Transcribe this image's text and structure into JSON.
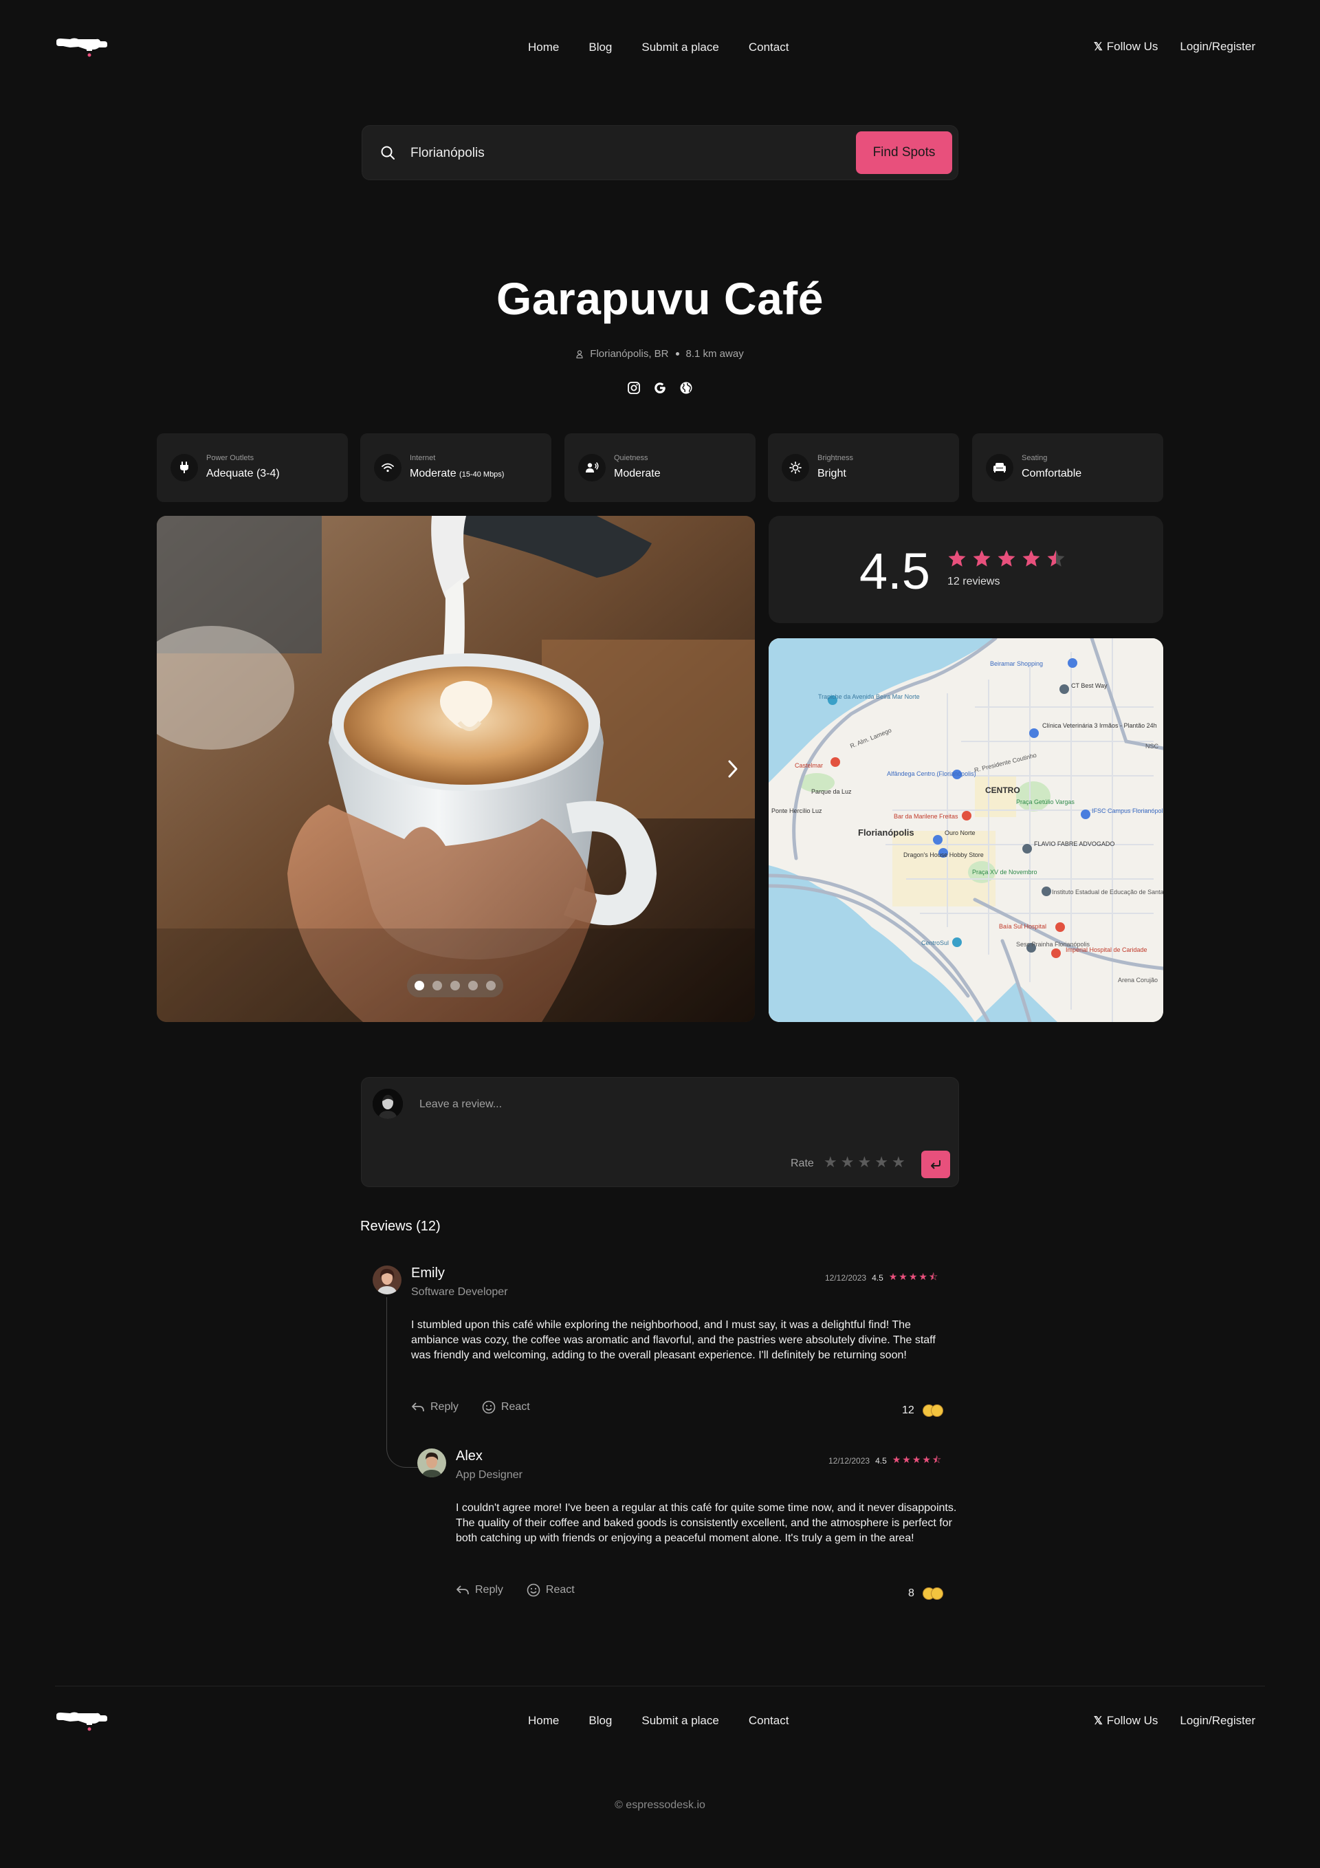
{
  "header": {
    "nav": [
      "Home",
      "Blog",
      "Submit a place",
      "Contact"
    ],
    "follow": "Follow Us",
    "login": "Login/Register"
  },
  "search": {
    "value": "Florianópolis",
    "button": "Find Spots"
  },
  "place": {
    "name": "Garapuvu Café",
    "location": "Florianópolis, BR",
    "distance": "8.1 km away",
    "socials": [
      "instagram-icon",
      "google-icon",
      "globe-icon"
    ]
  },
  "amenities": [
    {
      "label": "Power Outlets",
      "value": "Adequate (3-4)",
      "note": "",
      "icon": "plug-icon"
    },
    {
      "label": "Internet",
      "value": "Moderate",
      "note": "(15-40 Mbps)",
      "icon": "wifi-icon"
    },
    {
      "label": "Quietness",
      "value": "Moderate",
      "note": "",
      "icon": "voice-icon"
    },
    {
      "label": "Brightness",
      "value": "Bright",
      "note": "",
      "icon": "sun-icon"
    },
    {
      "label": "Seating",
      "value": "Comfortable",
      "note": "",
      "icon": "sofa-icon"
    }
  ],
  "gallery": {
    "total": 5,
    "current": 1
  },
  "rating": {
    "score": "4.5",
    "stars": 4.5,
    "reviews": "12 reviews"
  },
  "map": {
    "labels": [
      "CENTRO",
      "Florianópolis",
      "Parque da Luz",
      "Praça XV de Novembro",
      "Baía Sul Hospital",
      "Imperial Hospital de Caridade",
      "Instituto Estadual de Educação de Santa...",
      "FLAVIO FABRE ADVOGADO",
      "IFSC Campus Florianópolis",
      "Praça Getúlio Vargas",
      "CT Best Way",
      "Trapiche da Avenida Beira Mar Norte",
      "Beiramar Shopping",
      "Alfândega Centro (Florianópolis)",
      "Bar da Marilene Freitas",
      "Ouro Norte",
      "Dragon's House Hobby Store",
      "CentroSul",
      "Sesc Prainha Florianópolis",
      "Castelmar",
      "Ponte Hercílio Luz",
      "Arena Corujão",
      "R. Alm. Lamego",
      "R. Presidente Coutinho",
      "Clínica Veterinária 3 Irmãos - Plantão 24h",
      "NSC"
    ],
    "colors": {
      "water": "#a9d6ea",
      "land": "#f3f1ec",
      "road": "#aeb8c8",
      "park": "#cfe8c4",
      "pin_red": "#e2523f",
      "pin_blue": "#4a7ede"
    }
  },
  "composer": {
    "placeholder": "Leave a review...",
    "rate_label": "Rate",
    "stars": [
      "★",
      "★",
      "★",
      "★",
      "★"
    ]
  },
  "reviews_heading": "Reviews (12)",
  "reviews": [
    {
      "name": "Emily",
      "role": "Software Developer",
      "date": "12/12/2023",
      "score": "4.5",
      "stars": "★★★★⯪",
      "text": "I stumbled upon this café while exploring the neighborhood, and I must say, it was a delightful find! The ambiance was cozy, the coffee was aromatic and flavorful, and the pastries were absolutely divine. The staff was friendly and welcoming, adding to the overall pleasant experience. I'll definitely be returning soon!",
      "reply": "Reply",
      "react": "React",
      "reactions": "12"
    },
    {
      "name": "Alex",
      "role": "App Designer",
      "date": "12/12/2023",
      "score": "4.5",
      "stars": "★★★★⯪",
      "text": "I couldn't agree more! I've been a regular at this café for quite some time now, and it never disappoints. The quality of their coffee and baked goods is consistently excellent, and the atmosphere is perfect for both catching up with friends or enjoying a peaceful moment alone. It's truly a gem in the area!",
      "reply": "Reply",
      "react": "React",
      "reactions": "8"
    }
  ],
  "footer": {
    "nav": [
      "Home",
      "Blog",
      "Submit a place",
      "Contact"
    ],
    "follow": "Follow Us",
    "login": "Login/Register",
    "copyright": "© espressodesk.io"
  },
  "colors": {
    "accent": "#e8507c",
    "background": "#101010",
    "card": "#1e1e1e"
  }
}
